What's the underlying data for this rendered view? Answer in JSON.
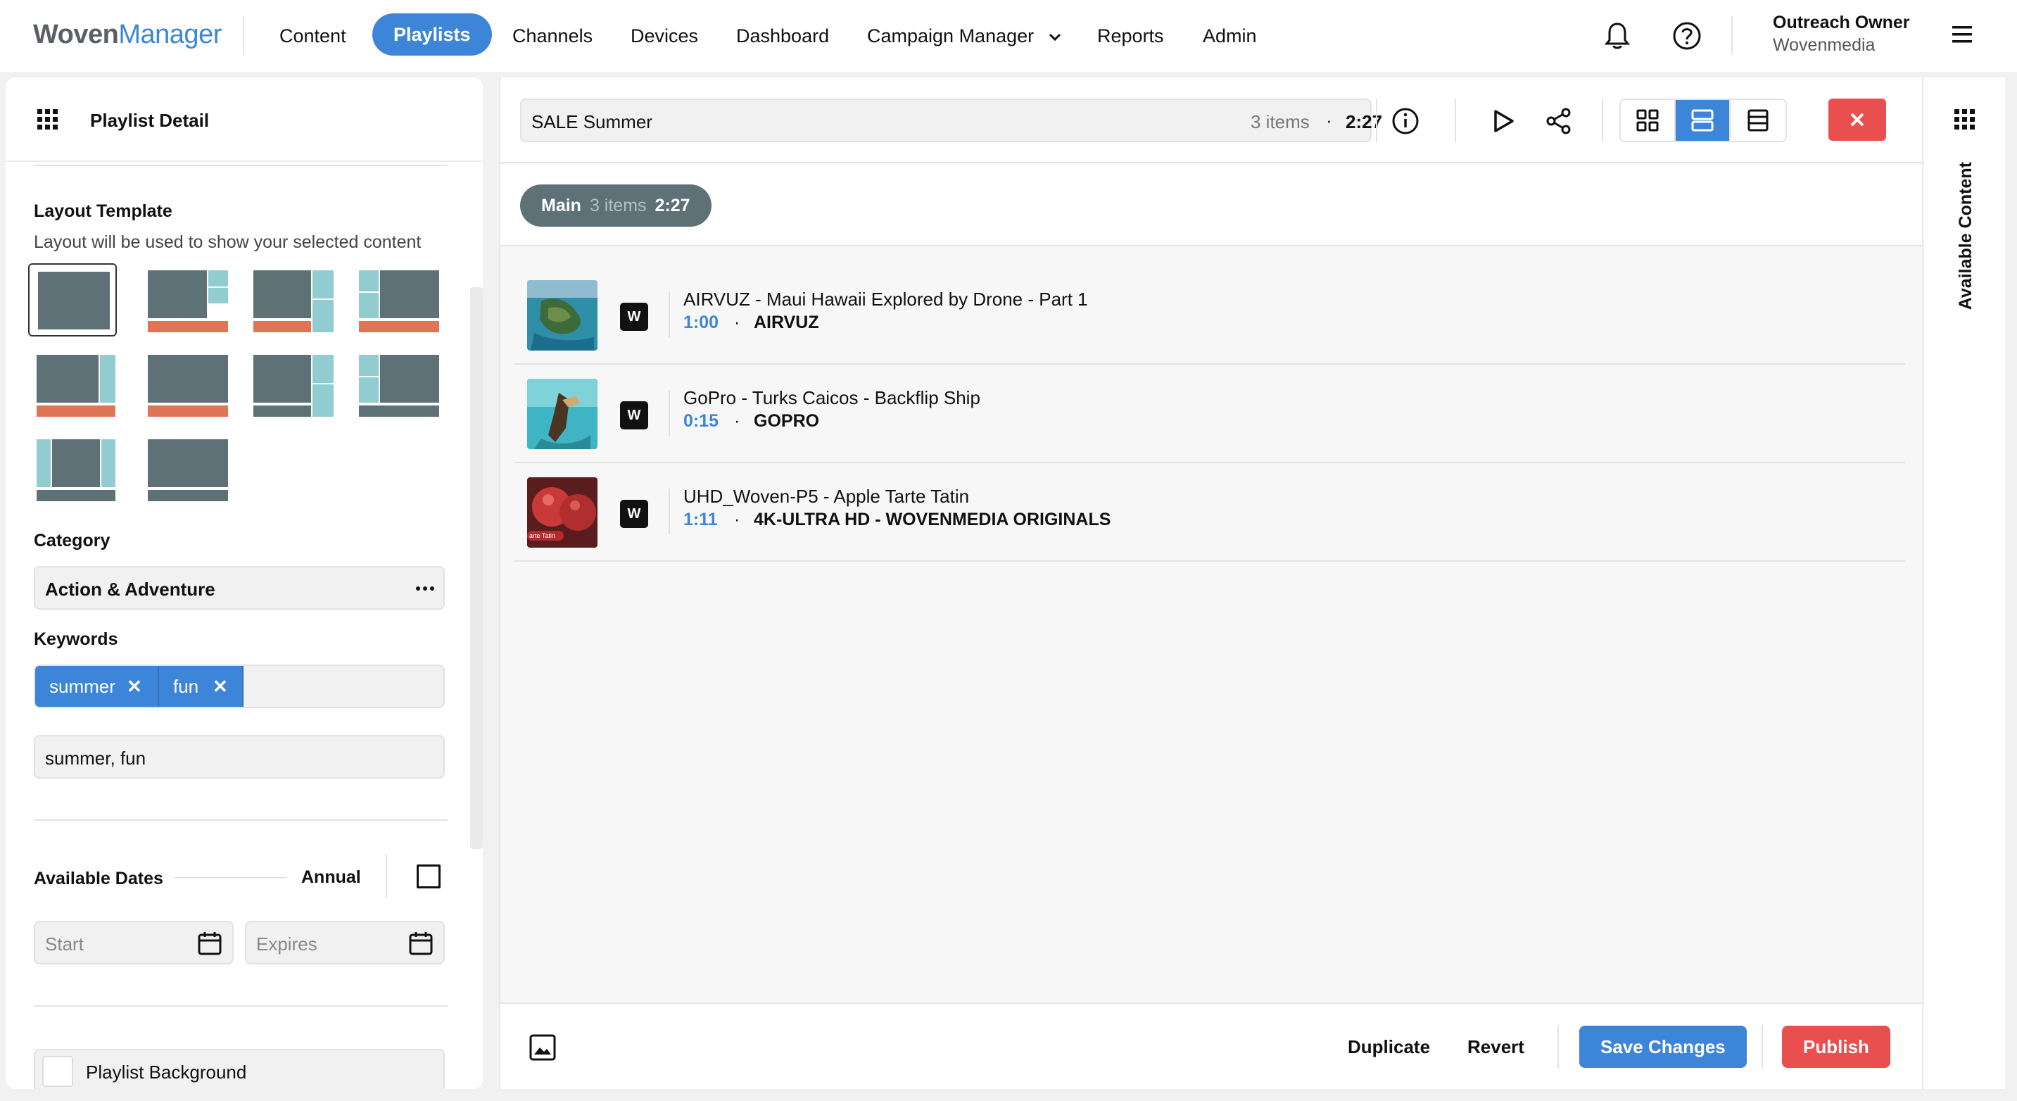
{
  "brand": {
    "logo_part1": "Woven",
    "logo_part2": "Manager",
    "accent": "#3d85d8",
    "danger": "#e94f4f"
  },
  "nav": {
    "items": [
      "Content",
      "Playlists",
      "Channels",
      "Devices",
      "Dashboard",
      "Campaign Manager",
      "Reports",
      "Admin"
    ],
    "active": "Playlists",
    "icons": [
      "bell-icon",
      "help-icon",
      "menu-icon"
    ]
  },
  "user": {
    "name": "Outreach Owner",
    "org": "Wovenmedia"
  },
  "left_panel": {
    "title": "Playlist Detail",
    "layout_template": {
      "label": "Layout Template",
      "description": "Layout will be used to show your selected content",
      "selected_index": 0
    },
    "category": {
      "label": "Category",
      "value": "Action & Adventure"
    },
    "keywords": {
      "label": "Keywords",
      "chips": [
        "summer",
        "fun"
      ],
      "text_value": "summer, fun"
    },
    "available_dates": {
      "label": "Available Dates",
      "annual_label": "Annual",
      "annual_checked": false,
      "start_placeholder": "Start",
      "expires_placeholder": "Expires"
    },
    "background": {
      "label": "Playlist Background"
    }
  },
  "playlist": {
    "name": "SALE Summer",
    "count": "3 items",
    "duration": "2:27",
    "zone": {
      "name": "Main",
      "count": "3 items",
      "duration": "2:27"
    },
    "items": [
      {
        "title": "AIRVUZ - Maui Hawaii Explored by Drone - Part 1",
        "duration": "1:00",
        "source": "AIRVUZ",
        "badge": "W"
      },
      {
        "title": "GoPro - Turks Caicos - Backflip Ship",
        "duration": "0:15",
        "source": "GOPRO",
        "badge": "W"
      },
      {
        "title": "UHD_Woven-P5 - Apple Tarte Tatin",
        "duration": "1:11",
        "source": "4K-ULTRA HD - WOVENMEDIA ORIGINALS",
        "badge": "W"
      }
    ],
    "thumbnail_overlay_text": "arte Tatin"
  },
  "actions": {
    "duplicate": "Duplicate",
    "revert": "Revert",
    "save": "Save Changes",
    "publish": "Publish"
  },
  "right_panel": {
    "label": "Available Content"
  },
  "separator_dot": "·",
  "remove_glyph": "✕"
}
